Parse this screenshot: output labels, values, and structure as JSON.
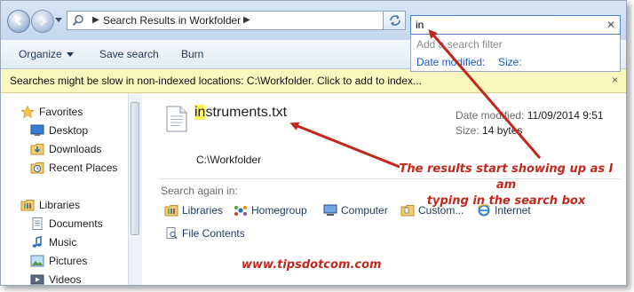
{
  "address_bar": {
    "path": "Search Results in Workfolder"
  },
  "search": {
    "value": "in",
    "suggest_hint": "Add a search filter",
    "filters": [
      "Date modified:",
      "Size:"
    ]
  },
  "toolbar": {
    "organize": "Organize",
    "save_search": "Save search",
    "burn": "Burn"
  },
  "infobar": {
    "text": "Searches might be slow in non-indexed locations: C:\\Workfolder. Click to add to index...",
    "close": "×"
  },
  "nav": {
    "favorites": "Favorites",
    "items": [
      "Desktop",
      "Downloads",
      "Recent Places"
    ],
    "libraries": "Libraries",
    "lib_items": [
      "Documents",
      "Music",
      "Pictures",
      "Videos"
    ]
  },
  "result": {
    "name_highlight": "in",
    "name_rest": "struments.txt",
    "path": "C:\\Workfolder",
    "date_label": "Date modified:",
    "date_value": "11/09/2014 9:51",
    "size_label": "Size:",
    "size_value": "14 bytes"
  },
  "search_again": {
    "label": "Search again in:",
    "locations": [
      "Libraries",
      "Homegroup",
      "Computer",
      "Custom...",
      "Internet",
      "File Contents"
    ]
  },
  "annotation": {
    "line1": "The results start showing up as I am",
    "line2": "typing in the search box",
    "watermark": "www.tipsdotcom.com",
    "color": "#c0281e"
  }
}
